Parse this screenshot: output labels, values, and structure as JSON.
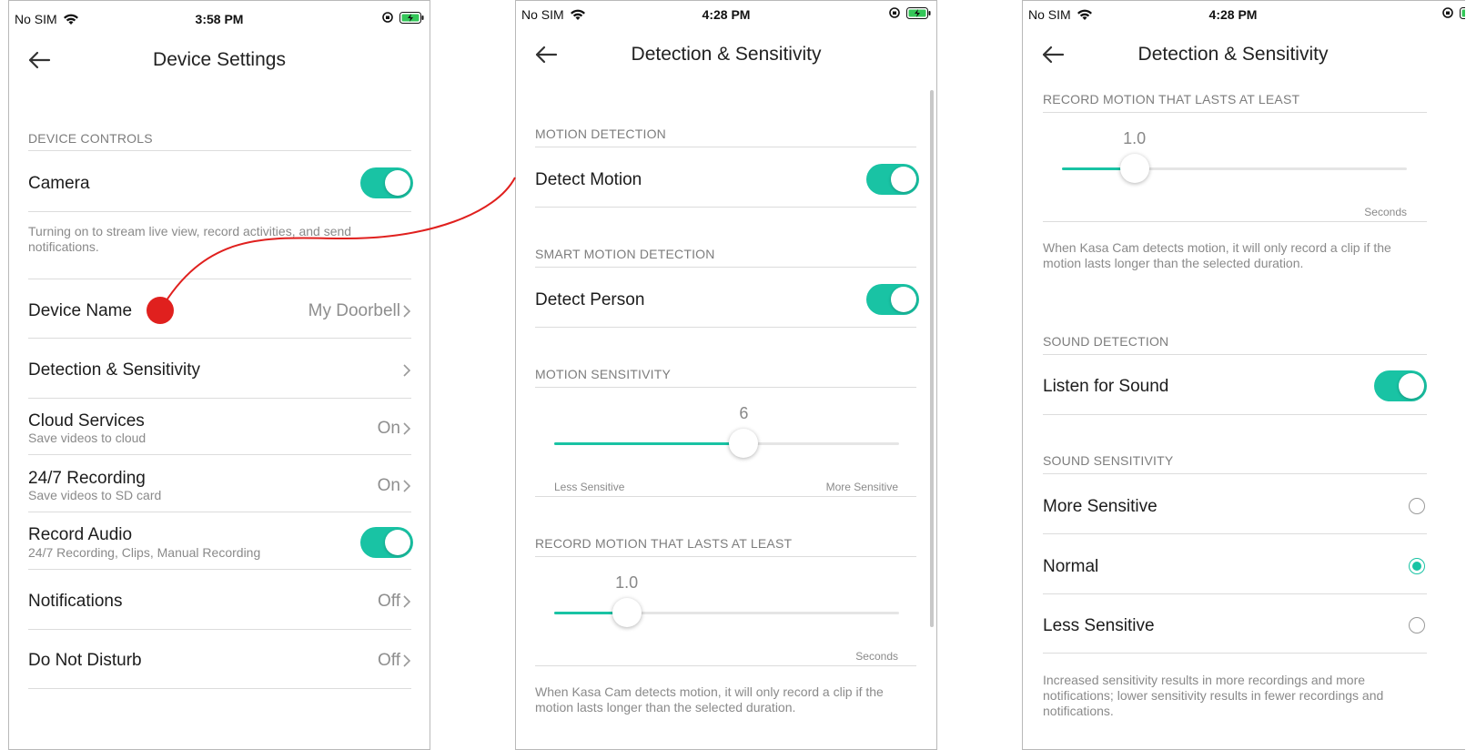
{
  "accent_color": "#19c3a4",
  "annotation_color": "#e0201e",
  "screen1": {
    "status": {
      "carrier": "No SIM",
      "time": "3:58 PM"
    },
    "title": "Device Settings",
    "section_device_controls": "DEVICE CONTROLS",
    "camera": {
      "label": "Camera",
      "toggle": "on"
    },
    "camera_desc": "Turning on to stream live view, record activities, and send notifications.",
    "device_name": {
      "label": "Device Name",
      "value": "My Doorbell"
    },
    "detection": {
      "label": "Detection & Sensitivity"
    },
    "cloud": {
      "label": "Cloud Services",
      "sub": "Save videos to cloud",
      "value": "On"
    },
    "recording": {
      "label": "24/7 Recording",
      "sub": "Save videos to SD card",
      "value": "On"
    },
    "record_audio": {
      "label": "Record Audio",
      "sub": "24/7 Recording, Clips, Manual Recording",
      "toggle": "on"
    },
    "notifications": {
      "label": "Notifications",
      "value": "Off"
    },
    "dnd": {
      "label": "Do Not Disturb",
      "value": "Off"
    }
  },
  "screen2": {
    "status": {
      "carrier": "No SIM",
      "time": "4:28 PM"
    },
    "title": "Detection & Sensitivity",
    "section_motion": "MOTION DETECTION",
    "detect_motion": {
      "label": "Detect Motion",
      "toggle": "on"
    },
    "section_smart": "SMART MOTION DETECTION",
    "detect_person": {
      "label": "Detect Person",
      "toggle": "on"
    },
    "section_sensitivity": "MOTION SENSITIVITY",
    "sensitivity": {
      "value": "6",
      "fraction": 0.55,
      "min_label": "Less Sensitive",
      "max_label": "More Sensitive"
    },
    "section_record": "RECORD MOTION THAT LASTS AT LEAST",
    "duration": {
      "value": "1.0",
      "fraction": 0.21,
      "unit": "Seconds"
    },
    "duration_desc": "When Kasa Cam detects motion, it will only record a clip if the motion lasts longer than the selected duration."
  },
  "screen3": {
    "status": {
      "carrier": "No SIM",
      "time": "4:28 PM"
    },
    "title": "Detection & Sensitivity",
    "section_record": "RECORD MOTION THAT LASTS AT LEAST",
    "duration": {
      "value": "1.0",
      "fraction": 0.21,
      "unit": "Seconds"
    },
    "duration_desc": "When Kasa Cam detects motion, it will only record a clip if the motion lasts longer than the selected duration.",
    "section_sound": "SOUND DETECTION",
    "listen": {
      "label": "Listen for Sound",
      "toggle": "on"
    },
    "section_sound_sens": "SOUND SENSITIVITY",
    "options": [
      {
        "label": "More Sensitive",
        "selected": false
      },
      {
        "label": "Normal",
        "selected": true
      },
      {
        "label": "Less Sensitive",
        "selected": false
      }
    ],
    "sound_desc": "Increased sensitivity results in more recordings and more notifications; lower sensitivity results in fewer recordings and notifications."
  }
}
